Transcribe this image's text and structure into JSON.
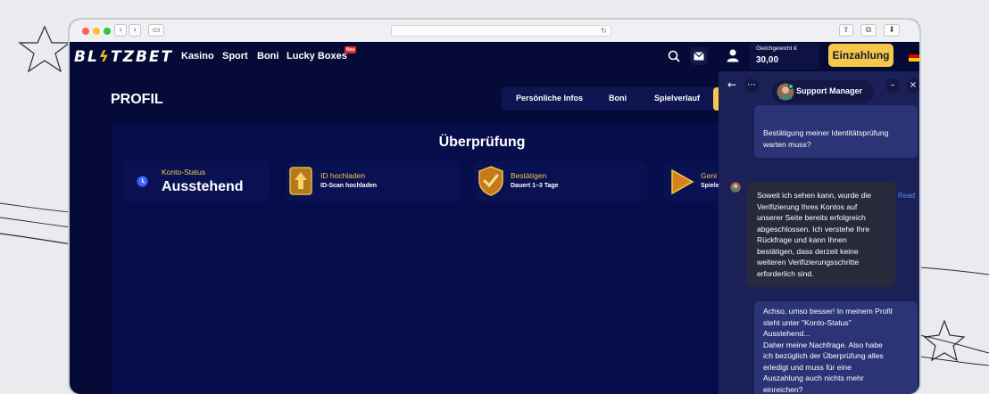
{
  "browser": {
    "url": ""
  },
  "site": {
    "logo_pre": "BL",
    "logo_bolt": "ϟ",
    "logo_post": "TZBET",
    "nav": [
      "Kasino",
      "Sport",
      "Boni",
      "Lucky Boxes"
    ],
    "nav_badge": "Neu",
    "balance_label": "Gleichgewicht €",
    "balance_value": "30,00",
    "deposit_label": "Einzahlung"
  },
  "profile": {
    "title": "PROFIL",
    "tabs": [
      "Persönliche Infos",
      "Boni",
      "Spielverlauf"
    ],
    "card_title": "Überprüfung",
    "steps": [
      {
        "label": "Konto-Status",
        "value": "Ausstehend",
        "icon": "clock-icon"
      },
      {
        "label": "ID hochladen",
        "value": "ID-Scan hochladen",
        "icon": "upload-icon"
      },
      {
        "label": "Bestätigen",
        "value": "Dauert 1–3 Tage",
        "icon": "shield-check-icon"
      },
      {
        "label": "Geni",
        "value": "Spiele",
        "icon": "play-icon"
      }
    ]
  },
  "chat": {
    "agent_name": "Support Manager",
    "messages": [
      {
        "from": "user",
        "lines": [
          "Bestätigung meiner Identitätsprüfung",
          "warten muss?"
        ]
      },
      {
        "from": "agent",
        "lines": [
          "Soweit ich sehen kann, wurde die",
          "Verifizierung Ihres Kontos auf",
          "unserer Seite bereits erfolgreich",
          "abgeschlossen. Ich verstehe Ihre",
          "Rückfrage und kann Ihnen",
          "bestätigen, dass derzeit keine",
          "weiteren Verifizierungsschritte",
          "erforderlich sind."
        ]
      },
      {
        "from": "user",
        "lines": [
          "Achso, umso besser! In meinem Profil",
          "steht unter \"Konto-Status\"",
          "Ausstehend...",
          "Daher meine Nachfrage. Also habe",
          "ich bezüglich der Überprüfung alles",
          "erledigt und muss für eine",
          "Auszahlung auch nichts mehr",
          "einreichen?"
        ]
      }
    ],
    "read_receipt": "Read"
  },
  "colors": {
    "accent": "#f4c84a",
    "bg": "#060a36",
    "chat_bg": "#1b2156"
  }
}
